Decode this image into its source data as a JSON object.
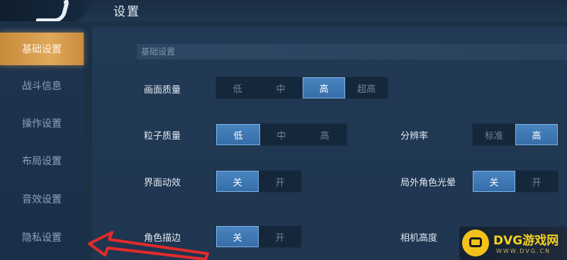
{
  "header": {
    "title": "设置"
  },
  "sidebar": {
    "items": [
      {
        "label": "基础设置",
        "active": true
      },
      {
        "label": "战斗信息",
        "active": false
      },
      {
        "label": "操作设置",
        "active": false
      },
      {
        "label": "布局设置",
        "active": false
      },
      {
        "label": "音效设置",
        "active": false
      },
      {
        "label": "隐私设置",
        "active": false
      }
    ]
  },
  "section": {
    "title": "基础设置"
  },
  "settings": {
    "picture_quality": {
      "label": "画面质量",
      "options": [
        "低",
        "中",
        "高",
        "超高"
      ],
      "selected": "高"
    },
    "particle_quality": {
      "label": "粒子质量",
      "options": [
        "低",
        "中",
        "高"
      ],
      "selected": "低"
    },
    "resolution": {
      "label": "分辨率",
      "options": [
        "标准",
        "高"
      ],
      "selected": "高"
    },
    "ui_effects": {
      "label": "界面动效",
      "options": [
        "关",
        "开"
      ],
      "selected": "关"
    },
    "outline_glow": {
      "label": "局外角色光晕",
      "options": [
        "关",
        "开"
      ],
      "selected": "关"
    },
    "char_outline": {
      "label": "角色描边",
      "options": [
        "关",
        "开"
      ],
      "selected": "关"
    },
    "camera_height": {
      "label": "相机高度"
    }
  },
  "watermark": {
    "brand": "DVG游戏网",
    "domain": "WWW.DVG.CN"
  },
  "colors": {
    "accent_active": "#d9a050",
    "toggle_selected": "#3f79b5",
    "background": "#1c3046"
  }
}
